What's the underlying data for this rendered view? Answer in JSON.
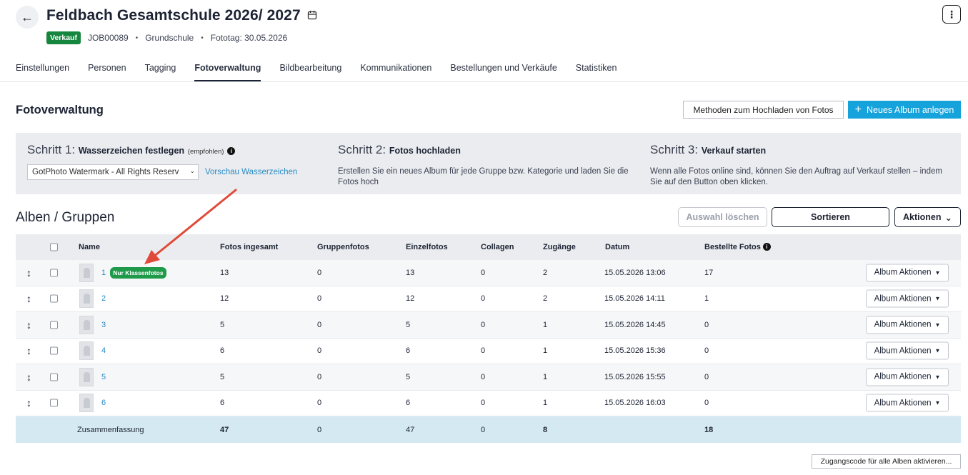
{
  "header": {
    "title": "Feldbach Gesamtschule 2026/ 2027",
    "status_badge": "Verkauf",
    "job_id": "JOB00089",
    "school_type": "Grundschule",
    "photo_day": "Fototag: 30.05.2026",
    "back_icon": "arrow-left-icon",
    "calendar_icon": "calendar-icon",
    "menu_icon": "kebab-menu-icon"
  },
  "tabs": [
    {
      "label": "Einstellungen"
    },
    {
      "label": "Personen"
    },
    {
      "label": "Tagging"
    },
    {
      "label": "Fotoverwaltung",
      "active": true
    },
    {
      "label": "Bildbearbeitung"
    },
    {
      "label": "Kommunikationen"
    },
    {
      "label": "Bestellungen und Verkäufe"
    },
    {
      "label": "Statistiken"
    }
  ],
  "section": {
    "title": "Fotoverwaltung",
    "upload_methods_label": "Methoden zum Hochladen von Fotos",
    "new_album_label": "Neues Album anlegen"
  },
  "steps": {
    "step1": {
      "prefix": "Schritt 1:",
      "title": "Wasserzeichen festlegen",
      "hint": "(empfohlen)",
      "select_value": "GotPhoto Watermark - All Rights Reserv",
      "preview_link": "Vorschau Wasserzeichen"
    },
    "step2": {
      "prefix": "Schritt 2:",
      "title": "Fotos hochladen",
      "text": "Erstellen Sie ein neues Album für jede Gruppe bzw. Kategorie und laden Sie die Fotos hoch"
    },
    "step3": {
      "prefix": "Schritt 3:",
      "title": "Verkauf starten",
      "text": "Wenn alle Fotos online sind, können Sie den Auftrag auf Verkauf stellen – indem Sie auf den Button oben klicken."
    }
  },
  "albums": {
    "title": "Alben / Gruppen",
    "clear_selection_label": "Auswahl löschen",
    "sort_label": "Sortieren",
    "actions_label": "Aktionen"
  },
  "table": {
    "columns": {
      "name": "Name",
      "total": "Fotos ingesamt",
      "group": "Gruppenfotos",
      "single": "Einzelfotos",
      "collages": "Collagen",
      "access": "Zugänge",
      "date": "Datum",
      "ordered": "Bestellte Fotos"
    },
    "rows": [
      {
        "name": "1",
        "tag": "Nur Klassenfotos",
        "total": "13",
        "group": "0",
        "single": "13",
        "collages": "0",
        "access": "2",
        "date": "15.05.2026 13:06",
        "ordered": "17",
        "action": "Album Aktionen"
      },
      {
        "name": "2",
        "total": "12",
        "group": "0",
        "single": "12",
        "collages": "0",
        "access": "2",
        "date": "15.05.2026 14:11",
        "ordered": "1",
        "action": "Album Aktionen"
      },
      {
        "name": "3",
        "total": "5",
        "group": "0",
        "single": "5",
        "collages": "0",
        "access": "1",
        "date": "15.05.2026 14:45",
        "ordered": "0",
        "action": "Album Aktionen"
      },
      {
        "name": "4",
        "total": "6",
        "group": "0",
        "single": "6",
        "collages": "0",
        "access": "1",
        "date": "15.05.2026 15:36",
        "ordered": "0",
        "action": "Album Aktionen"
      },
      {
        "name": "5",
        "total": "5",
        "group": "0",
        "single": "5",
        "collages": "0",
        "access": "1",
        "date": "15.05.2026 15:55",
        "ordered": "0",
        "action": "Album Aktionen"
      },
      {
        "name": "6",
        "total": "6",
        "group": "0",
        "single": "6",
        "collages": "0",
        "access": "1",
        "date": "15.05.2026 16:03",
        "ordered": "0",
        "action": "Album Aktionen"
      }
    ],
    "summary": {
      "label": "Zusammenfassung",
      "total": "47",
      "group": "0",
      "single": "47",
      "collages": "0",
      "access": "8",
      "ordered": "18"
    }
  },
  "footer": {
    "access_code_label": "Zugangscode für alle Alben aktivieren..."
  },
  "colors": {
    "primary": "#16a3dc",
    "status_green": "#16863e",
    "link": "#2a8bc4",
    "annotation_arrow": "#e04a3a"
  }
}
